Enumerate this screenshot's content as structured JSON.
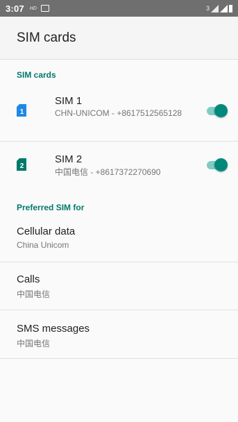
{
  "status_bar": {
    "time": "3:07",
    "hd_label": "HD",
    "network_label": "3"
  },
  "app_bar": {
    "title": "SIM cards"
  },
  "sections": {
    "sim_cards_header": "SIM cards",
    "preferred_header": "Preferred SIM for"
  },
  "sims": [
    {
      "slot": "1",
      "title": "SIM 1",
      "subtitle": "CHN-UNICOM - +8617512565128",
      "enabled": true,
      "color": "#1e88e5"
    },
    {
      "slot": "2",
      "title": "SIM 2",
      "subtitle": "中国电信 - +8617372270690",
      "enabled": true,
      "color": "#00796b"
    }
  ],
  "preferred": {
    "cellular_data": {
      "title": "Cellular data",
      "value": "China Unicom"
    },
    "calls": {
      "title": "Calls",
      "value": "中国电信"
    },
    "sms": {
      "title": "SMS messages",
      "value": "中国电信"
    }
  },
  "colors": {
    "accent": "#00897b",
    "accent_track": "#80cbc4",
    "section_header": "#00796b"
  }
}
